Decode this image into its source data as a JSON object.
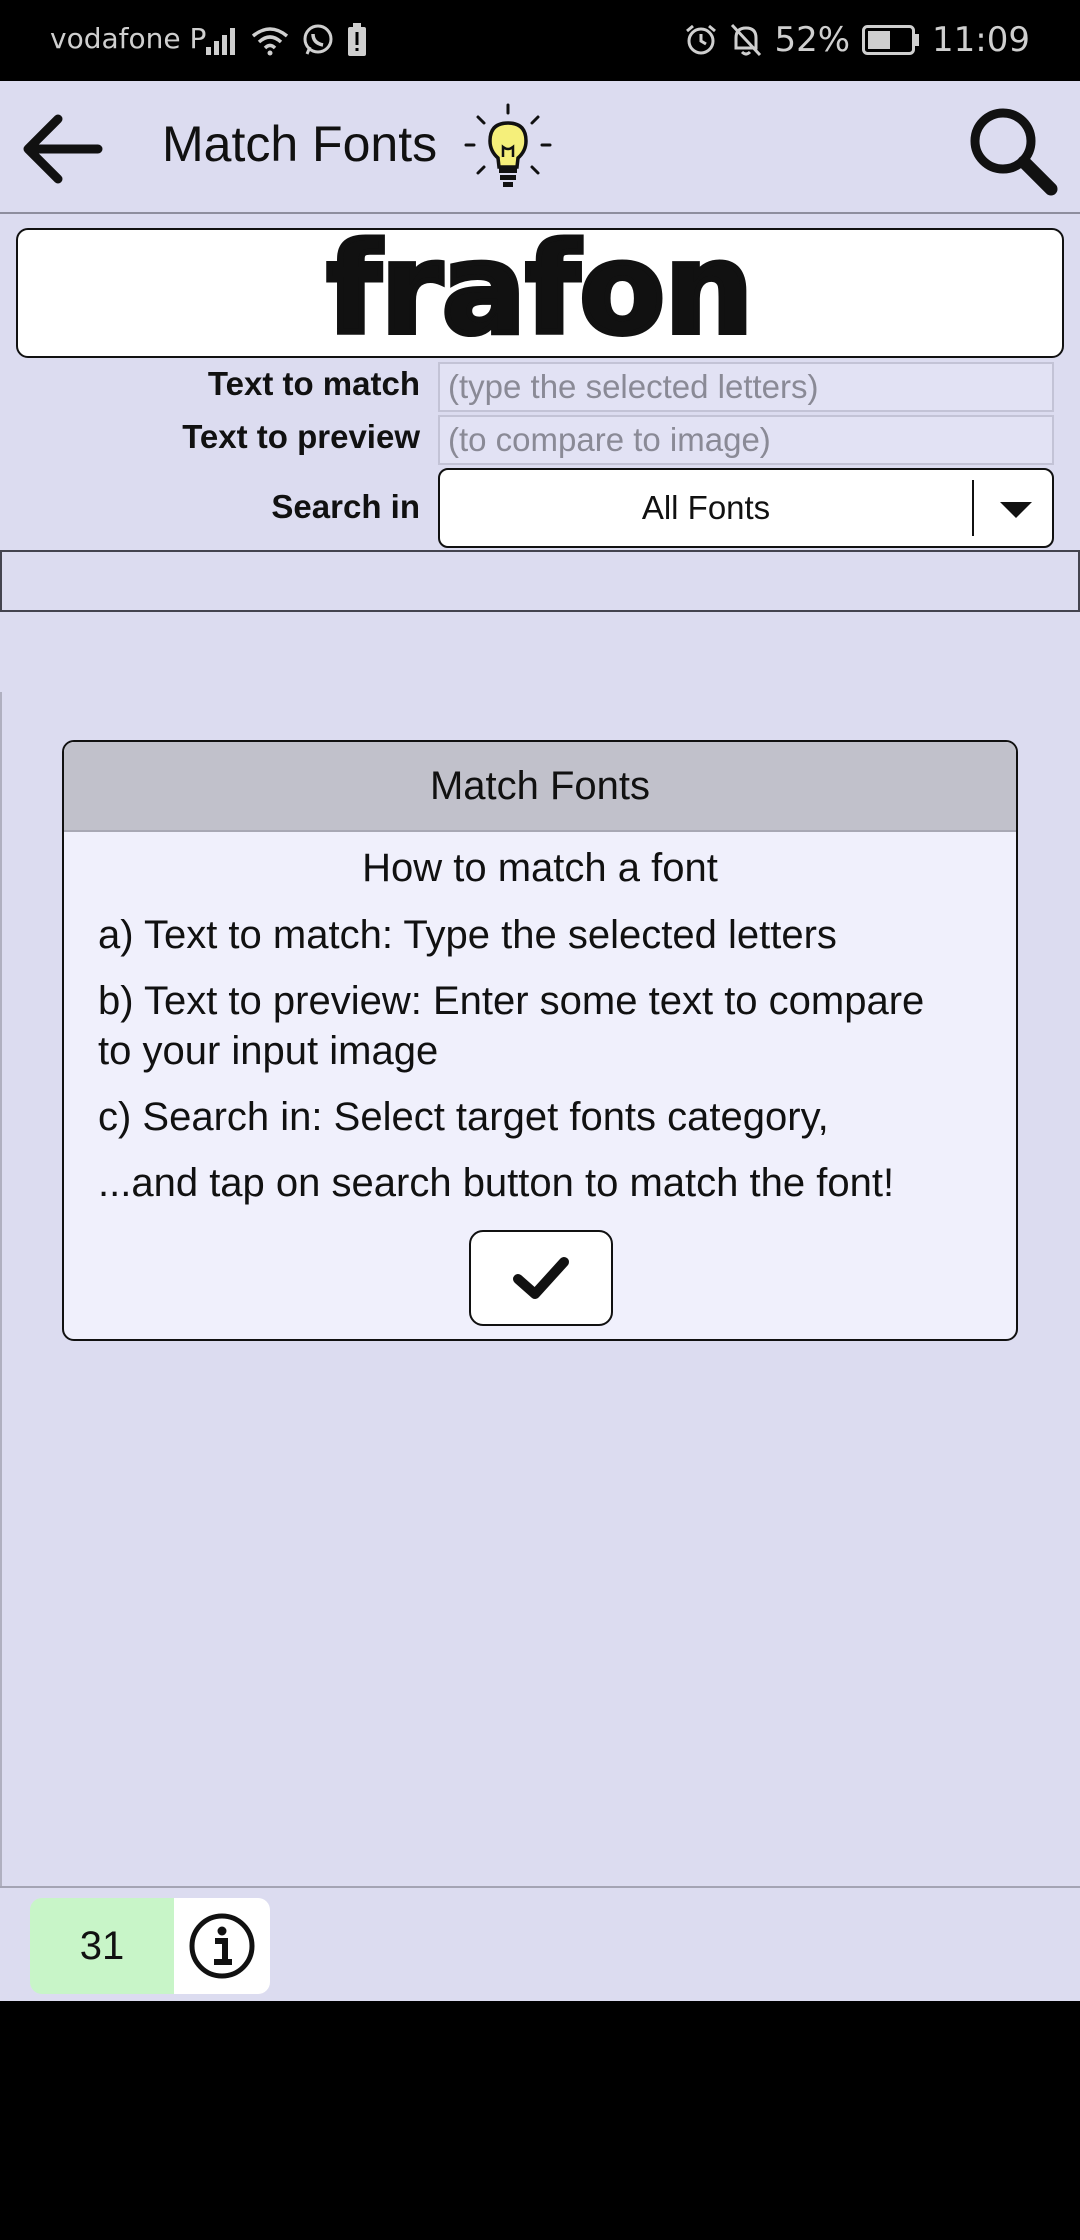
{
  "status_bar": {
    "carrier": "vodafone P",
    "battery_percent": "52%",
    "time": "11:09"
  },
  "toolbar": {
    "title": "Match Fonts",
    "icons": [
      "back-arrow-icon",
      "lightbulb-icon",
      "search-icon"
    ]
  },
  "sample_image": {
    "text": "frafon"
  },
  "form": {
    "text_to_match_label": "Text to match",
    "text_to_match_placeholder": "(type the selected letters)",
    "text_to_preview_label": "Text to preview",
    "text_to_preview_placeholder": "(to compare to image)",
    "search_in_label": "Search in",
    "search_in_value": "All Fonts"
  },
  "dialog": {
    "title": "Match Fonts",
    "subtitle": "How to match a font",
    "line_a": "a) Text to match: Type the selected letters",
    "line_b1": "b) Text to preview: Enter some text to compare",
    "line_b2": "to your input image",
    "line_c": "c) Search in: Select target fonts category,",
    "line_d": "...and tap on search button to match the font!"
  },
  "footer": {
    "credits": "31"
  },
  "colors": {
    "background": "#dcdcf0",
    "dialog_header": "#c1c1cb",
    "dialog_body": "#f0f0fc",
    "credits_bg": "#c8f5c8",
    "bulb_yellow": "#f5ef7a"
  }
}
